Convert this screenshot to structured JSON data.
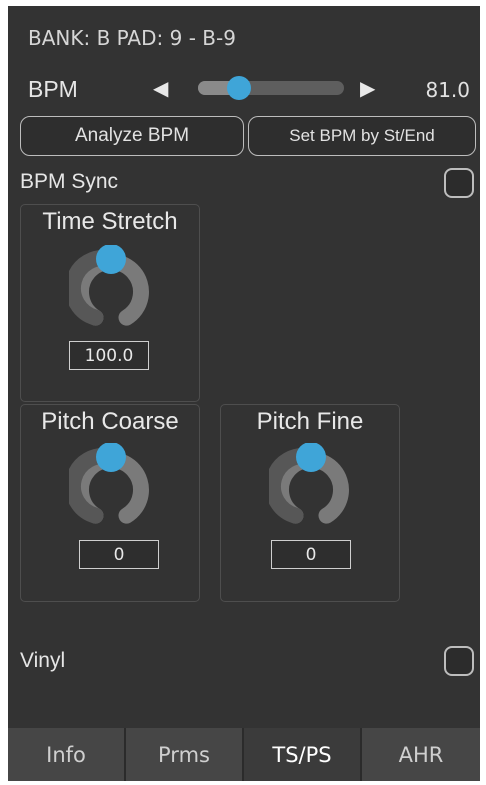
{
  "header": {
    "bank_pad": "BANK: B PAD: 9 - B-9"
  },
  "bpm": {
    "label": "BPM",
    "value_text": "81.0",
    "slider_fraction": 0.28,
    "left_arrow": "◀",
    "right_arrow": "▶"
  },
  "buttons": {
    "analyze": "Analyze BPM",
    "set_by_st_end": "Set BPM by St/End"
  },
  "bpm_sync": {
    "label": "BPM Sync",
    "checked": false
  },
  "time_stretch": {
    "title": "Time Stretch",
    "value": "100.0",
    "knob_fraction": 0.5
  },
  "pitch_coarse": {
    "title": "Pitch Coarse",
    "value": "0",
    "knob_fraction": 0.5
  },
  "pitch_fine": {
    "title": "Pitch Fine",
    "value": "0",
    "knob_fraction": 0.5
  },
  "vinyl": {
    "label": "Vinyl",
    "checked": false
  },
  "tabs": [
    {
      "label": "Info",
      "active": false
    },
    {
      "label": "Prms",
      "active": false
    },
    {
      "label": "TS/PS",
      "active": true
    },
    {
      "label": "AHR",
      "active": false
    }
  ],
  "colors": {
    "accent": "#3fa5d8",
    "panel_bg": "#333333",
    "tab_bg": "#464646"
  },
  "icons": {
    "knob": "rotary-knob-icon",
    "left_arrow": "triangle-left-icon",
    "right_arrow": "triangle-right-icon"
  }
}
